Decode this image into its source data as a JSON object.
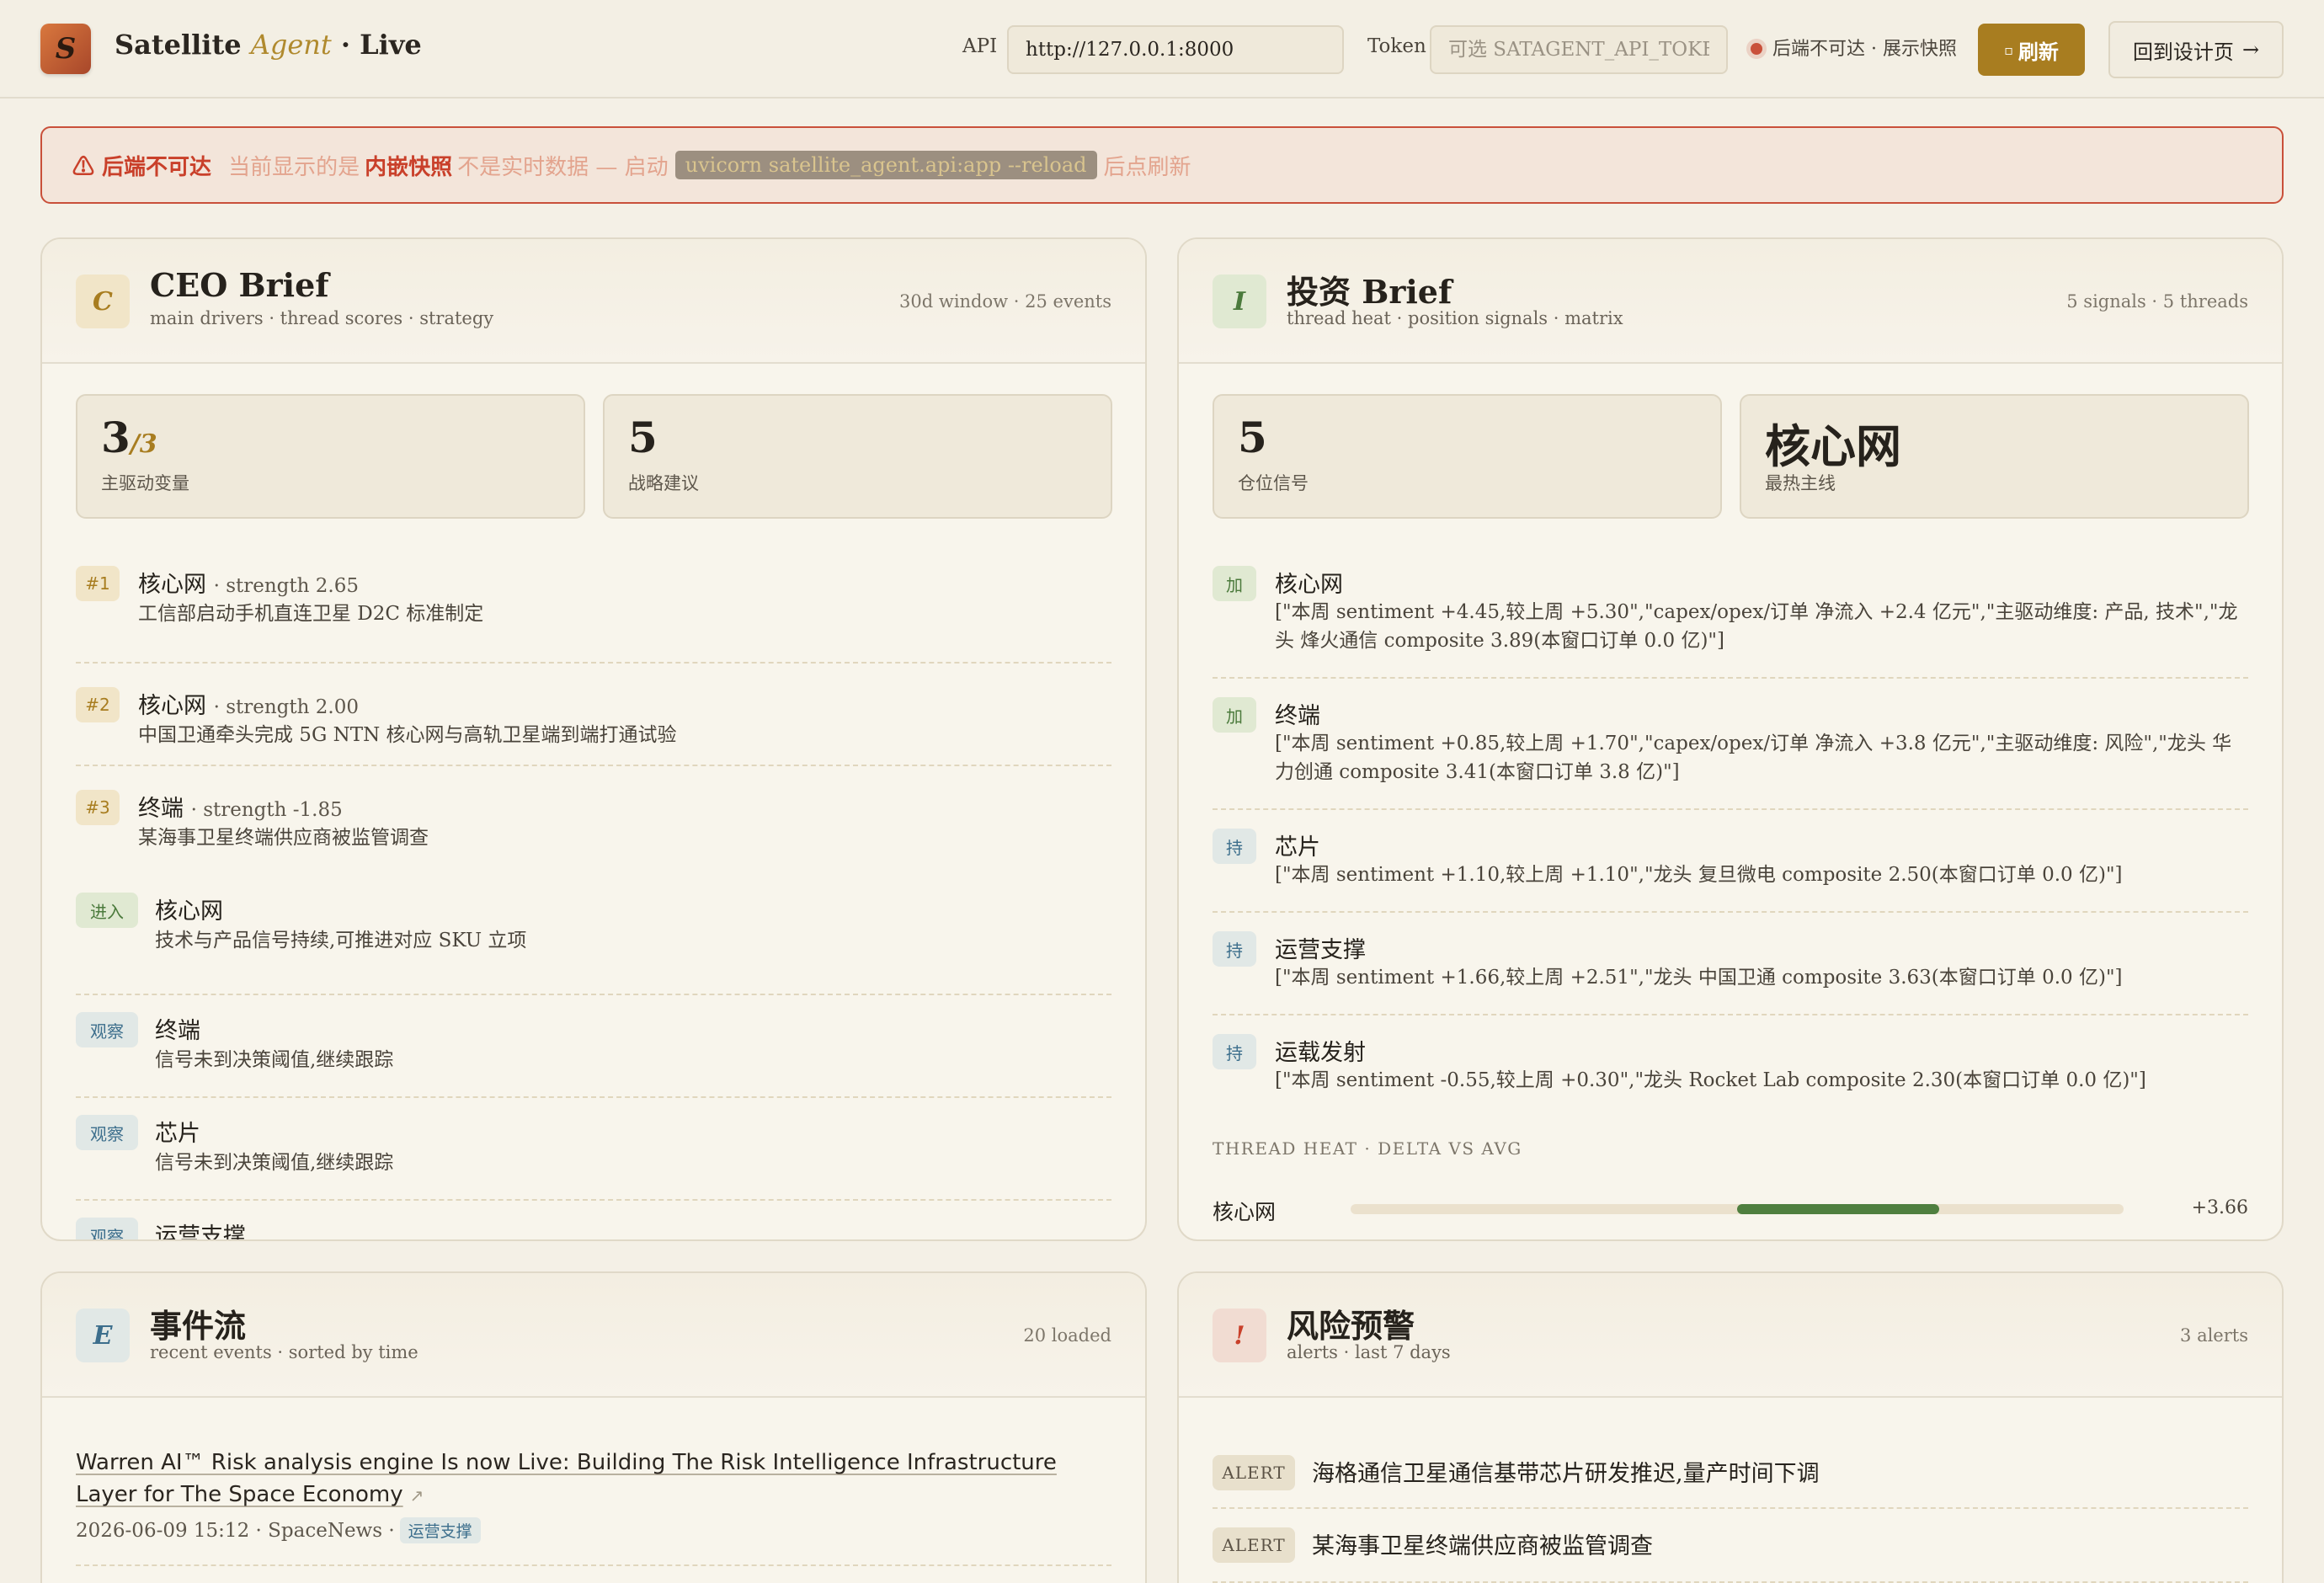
{
  "header": {
    "logo_letter": "S",
    "title_main": "Satellite",
    "title_accent": "Agent",
    "title_suffix": "· Live",
    "api_label": "API",
    "api_value": "http://127.0.0.1:8000",
    "token_label": "Token",
    "token_placeholder": "可选 SATAGENT_API_TOKEN",
    "status_text": "后端不可达 · 展示快照",
    "refresh_label": "刷新",
    "back_label": "回到设计页",
    "back_arrow": "→"
  },
  "banner": {
    "warn": "⚠ 后端不可达",
    "text1": "当前显示的是",
    "strong": "内嵌快照",
    "text2": "不是实时数据 — 启动",
    "code": "uvicorn satellite_agent.api:app --reload",
    "text3": "后点刷新"
  },
  "ceo": {
    "icon": "C",
    "title": "CEO Brief",
    "subtitle": "main drivers · thread scores · strategy",
    "meta": "30d window · 25 events",
    "stats": [
      {
        "num": "3",
        "of": "/3",
        "label": "主驱动变量"
      },
      {
        "num": "5",
        "of": "",
        "label": "战略建议"
      }
    ],
    "drivers": [
      {
        "rank": "#1",
        "name": "核心网",
        "strength": "· strength 2.65",
        "desc": "工信部启动手机直连卫星 D2C 标准制定"
      },
      {
        "rank": "#2",
        "name": "核心网",
        "strength": "· strength 2.00",
        "desc": "中国卫通牵头完成 5G NTN 核心网与高轨卫星端到端打通试验"
      },
      {
        "rank": "#3",
        "name": "终端",
        "strength": "· strength -1.85",
        "desc": "某海事卫星终端供应商被监管调查"
      }
    ],
    "strategy": [
      {
        "tag": "进入",
        "name": "核心网",
        "desc": "技术与产品信号持续,可推进对应 SKU 立项"
      },
      {
        "tag": "观察",
        "name": "终端",
        "desc": "信号未到决策阈值,继续跟踪"
      },
      {
        "tag": "观察",
        "name": "芯片",
        "desc": "信号未到决策阈值,继续跟踪"
      },
      {
        "tag": "观察",
        "name": "运营支撑",
        "desc": ""
      }
    ]
  },
  "invest": {
    "icon": "I",
    "title": "投资 Brief",
    "subtitle": "thread heat · position signals · matrix",
    "meta": "5 signals · 5 threads",
    "stats": [
      {
        "num": "5",
        "label": "仓位信号"
      },
      {
        "num": "核心网",
        "label": "最热主线"
      }
    ],
    "signals": [
      {
        "tag": "加",
        "name": "核心网",
        "desc": "[\"本周 sentiment +4.45,较上周 +5.30\",\"capex/opex/订单 净流入 +2.4 亿元\",\"主驱动维度: 产品, 技术\",\"龙头 烽火通信 composite 3.89(本窗口订单 0.0 亿)\"]"
      },
      {
        "tag": "加",
        "name": "终端",
        "desc": "[\"本周 sentiment +0.85,较上周 +1.70\",\"capex/opex/订单 净流入 +3.8 亿元\",\"主驱动维度: 风险\",\"龙头 华力创通 composite 3.41(本窗口订单 3.8 亿)\"]"
      },
      {
        "tag": "持",
        "name": "芯片",
        "desc": "[\"本周 sentiment +1.10,较上周 +1.10\",\"龙头 复旦微电 composite 2.50(本窗口订单 0.0 亿)\"]"
      },
      {
        "tag": "持",
        "name": "运营支撑",
        "desc": "[\"本周 sentiment +1.66,较上周 +2.51\",\"龙头 中国卫通 composite 3.63(本窗口订单 0.0 亿)\"]"
      },
      {
        "tag": "持",
        "name": "运载发射",
        "desc": "[\"本周 sentiment -0.55,较上周 +0.30\",\"龙头 Rocket Lab composite 2.30(本窗口订单 0.0 亿)\"]"
      }
    ],
    "heat_title": "THREAD HEAT · DELTA VS AVG",
    "heat": [
      {
        "name": "核心网",
        "delta": 3.66,
        "delta_label": "+3.66"
      }
    ]
  },
  "events": {
    "icon": "E",
    "title": "事件流",
    "subtitle": "recent events · sorted by time",
    "meta": "20 loaded",
    "items": [
      {
        "title": "Warren AI™ Risk analysis engine Is now Live: Building The Risk Intelligence Infrastructure Layer for The Space Economy",
        "ext": "↗",
        "meta": "2026-06-09 15:12 · SpaceNews ·",
        "tag": "运营支撑"
      }
    ]
  },
  "risk": {
    "icon": "!",
    "title": "风险预警",
    "subtitle": "alerts · last 7 days",
    "meta": "3 alerts",
    "alerts": [
      {
        "tag": "ALERT",
        "text": "海格通信卫星通信基带芯片研发推迟,量产时间下调"
      },
      {
        "tag": "ALERT",
        "text": "某海事卫星终端供应商被监管调查"
      }
    ]
  },
  "colors": {
    "accent": "#a87d20",
    "danger": "#c9503a",
    "heat_bar": "#4f7f3f"
  }
}
